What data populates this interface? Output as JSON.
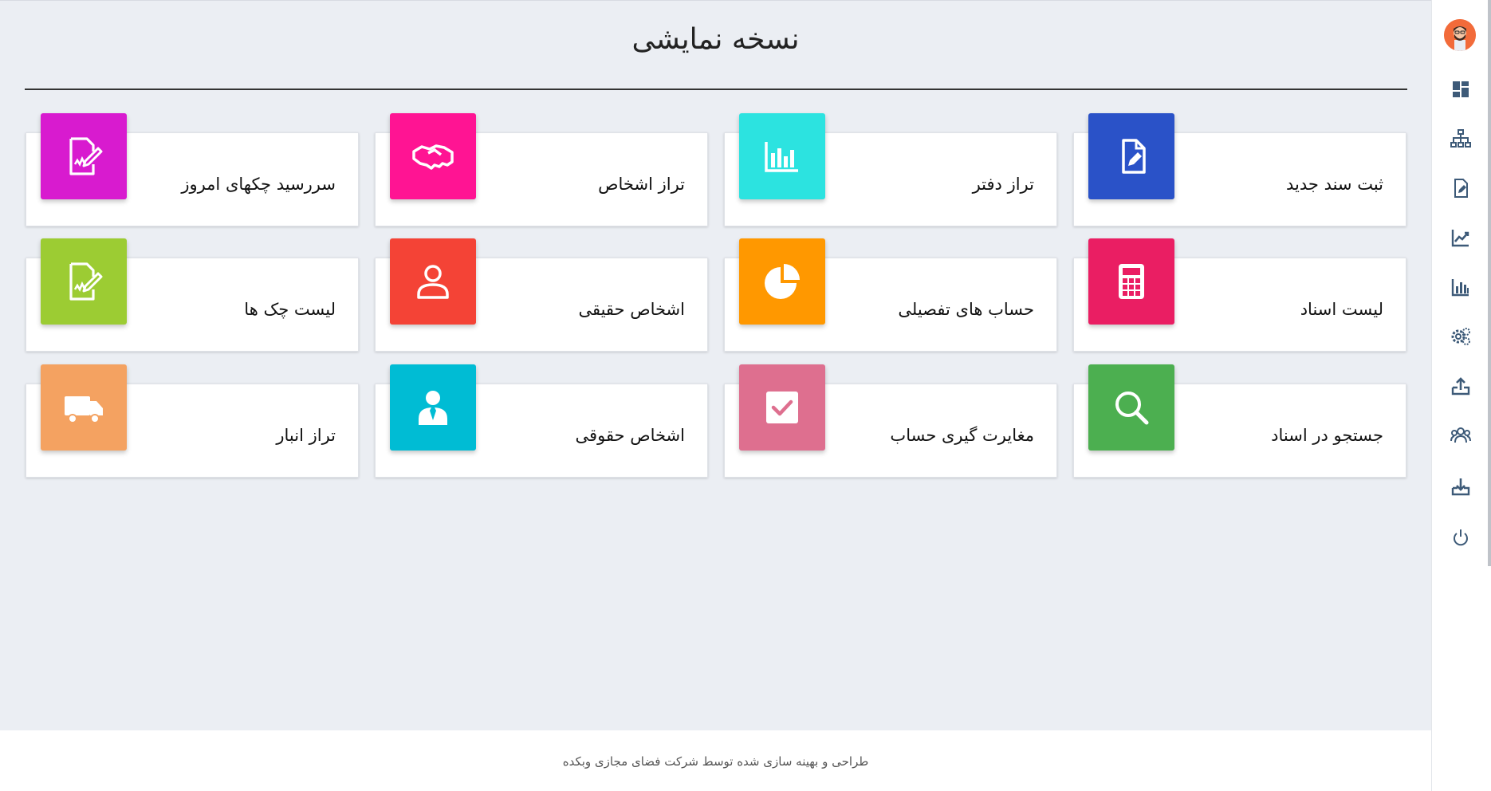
{
  "page": {
    "title": "نسخه نمایشی",
    "footer": "طراحی و بهینه سازی شده توسط شرکت فضای مجازی وبکده"
  },
  "cards": [
    {
      "label": "ثبت سند جدید",
      "icon": "document-edit-icon",
      "color": "#2a52c8"
    },
    {
      "label": "تراز دفتر",
      "icon": "bar-chart-icon",
      "color": "#2ce3e0"
    },
    {
      "label": "تراز اشخاص",
      "icon": "handshake-icon",
      "color": "#ff1493"
    },
    {
      "label": "سررسید چکهای امروز",
      "icon": "signed-document-icon",
      "color": "#d81bcf"
    },
    {
      "label": "لیست اسناد",
      "icon": "calculator-icon",
      "color": "#ea1e63"
    },
    {
      "label": "حساب های تفصیلی",
      "icon": "pie-chart-icon",
      "color": "#ff9800"
    },
    {
      "label": "اشخاص حقیقی",
      "icon": "user-icon",
      "color": "#f44336"
    },
    {
      "label": "لیست چک ها",
      "icon": "signed-document-icon",
      "color": "#9ccc33"
    },
    {
      "label": "جستجو در اسناد",
      "icon": "search-icon",
      "color": "#4caf50"
    },
    {
      "label": "مغایرت گیری حساب",
      "icon": "checkbox-icon",
      "color": "#de6f8f"
    },
    {
      "label": "اشخاص حقوقی",
      "icon": "business-person-icon",
      "color": "#00bcd4"
    },
    {
      "label": "تراز انبار",
      "icon": "truck-icon",
      "color": "#f4a261"
    }
  ],
  "sidebar": {
    "avatar_icon": "user-avatar-icon",
    "items": [
      {
        "icon": "dashboard-icon"
      },
      {
        "icon": "org-chart-icon"
      },
      {
        "icon": "document-edit-icon"
      },
      {
        "icon": "line-chart-icon"
      },
      {
        "icon": "bar-chart-icon"
      },
      {
        "icon": "settings-icon"
      },
      {
        "icon": "upload-icon"
      },
      {
        "icon": "users-icon"
      },
      {
        "icon": "download-icon"
      },
      {
        "icon": "power-icon"
      }
    ],
    "icon_color": "#3d5a78"
  }
}
